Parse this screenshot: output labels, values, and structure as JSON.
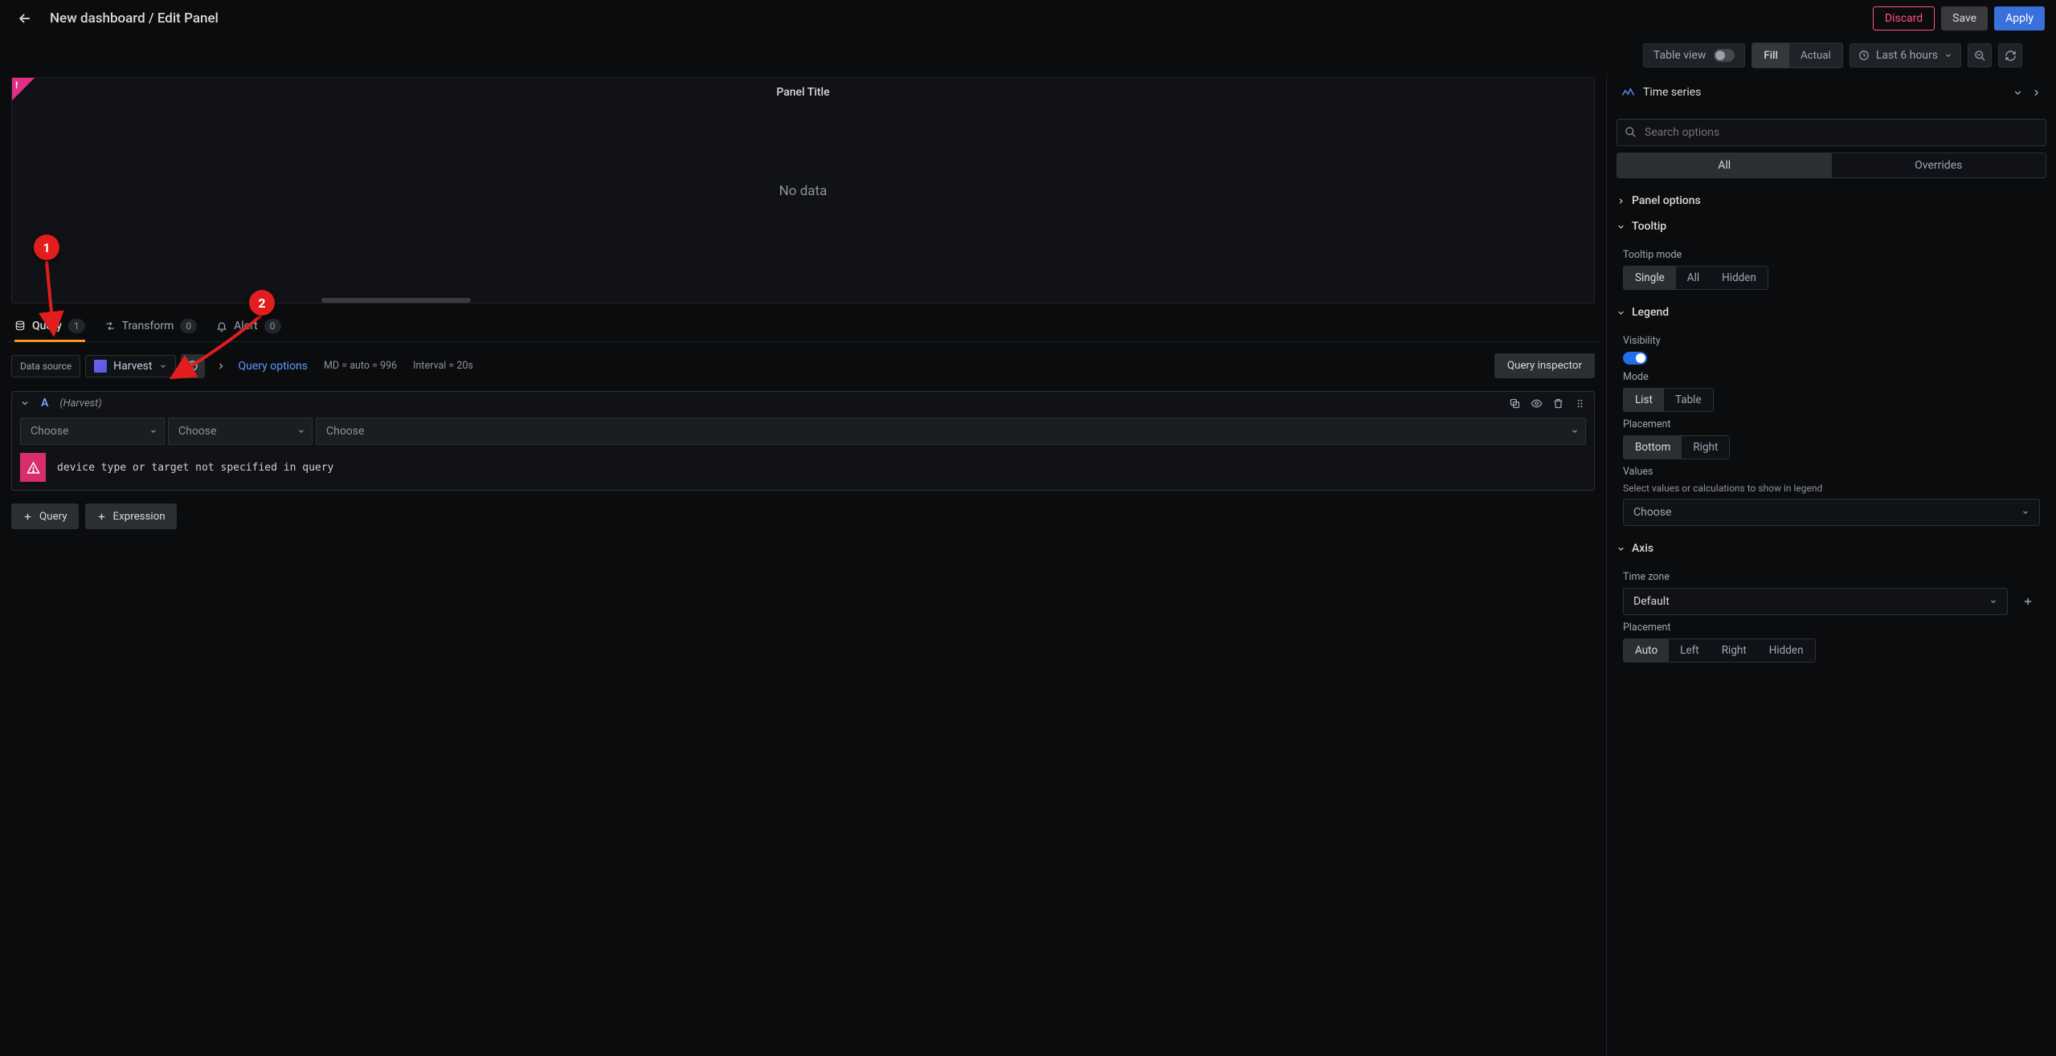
{
  "header": {
    "breadcrumb": "New dashboard / Edit Panel",
    "discard": "Discard",
    "save": "Save",
    "apply": "Apply"
  },
  "toolbar": {
    "table_view": "Table view",
    "fill": "Fill",
    "actual": "Actual",
    "time_range": "Last 6 hours"
  },
  "viz": {
    "type": "Time series"
  },
  "panel": {
    "title": "Panel Title",
    "no_data": "No data"
  },
  "tabs": {
    "query": "Query",
    "query_count": "1",
    "transform": "Transform",
    "transform_count": "0",
    "alert": "Alert",
    "alert_count": "0"
  },
  "datasource": {
    "label": "Data source",
    "name": "Harvest",
    "query_options": "Query options",
    "meta_md": "MD = auto = 996",
    "meta_interval": "Interval = 20s",
    "inspector": "Query inspector"
  },
  "query": {
    "letter": "A",
    "ds_hint": "(Harvest)",
    "choose": "Choose",
    "error": "device type or target not specified in query"
  },
  "add": {
    "query": "Query",
    "expression": "Expression"
  },
  "options": {
    "search_placeholder": "Search options",
    "all": "All",
    "overrides": "Overrides",
    "panel_options": "Panel options",
    "tooltip": {
      "title": "Tooltip",
      "mode_label": "Tooltip mode",
      "single": "Single",
      "all": "All",
      "hidden": "Hidden"
    },
    "legend": {
      "title": "Legend",
      "visibility": "Visibility",
      "mode": "Mode",
      "list": "List",
      "table": "Table",
      "placement": "Placement",
      "bottom": "Bottom",
      "right": "Right",
      "values": "Values",
      "values_desc": "Select values or calculations to show in legend",
      "choose": "Choose"
    },
    "axis": {
      "title": "Axis",
      "timezone": "Time zone",
      "default": "Default",
      "placement": "Placement",
      "auto": "Auto",
      "left": "Left",
      "right": "Right",
      "hidden": "Hidden"
    }
  },
  "annotations": {
    "one": "1",
    "two": "2"
  }
}
